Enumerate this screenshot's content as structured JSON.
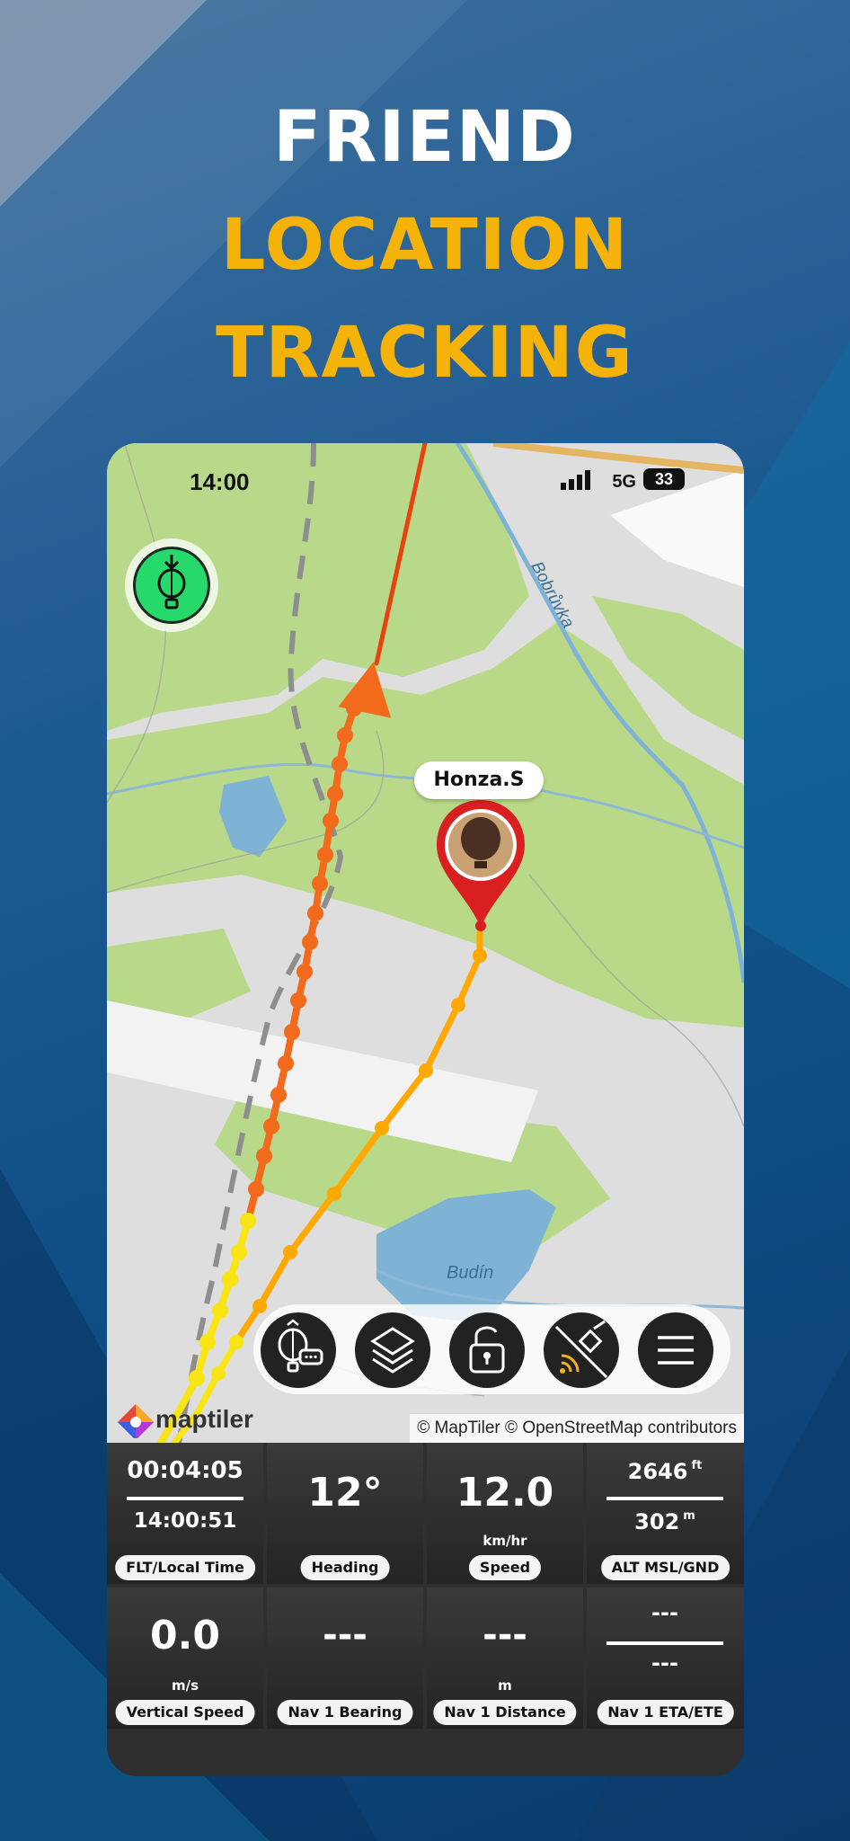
{
  "headline": {
    "line1": "FRIEND",
    "line2": "LOCATION",
    "line3": "TRACKING",
    "line1_color": "#ffffff",
    "accent_color": "#f5b30a"
  },
  "status_bar": {
    "time": "14:00",
    "network": "5G",
    "battery": "33"
  },
  "map": {
    "river_label": "Bobrůvka",
    "lake_label": "Budín",
    "friend_name": "Honza.S",
    "logo_text": "maptiler",
    "attribution": "© MapTiler © OpenStreetMap contributors",
    "track_color_own": "#f26a1b",
    "track_color_friend": "#ffa800",
    "track_color_tail": "#f8e513"
  },
  "toolbar": {
    "icons": [
      "balloon-chat-icon",
      "layers-icon",
      "unlock-icon",
      "satellite-icon",
      "menu-icon"
    ]
  },
  "instruments": {
    "flt_time": "00:04:05",
    "local_time": "14:00:51",
    "flt_label": "FLT/Local Time",
    "heading": "12°",
    "heading_label": "Heading",
    "speed": "12.0",
    "speed_unit": "km/hr",
    "speed_label": "Speed",
    "alt_msl": "2646",
    "alt_msl_unit": "ft",
    "alt_gnd": "302",
    "alt_gnd_unit": "m",
    "alt_label": "ALT MSL/GND",
    "vs": "0.0",
    "vs_unit": "m/s",
    "vs_label": "Vertical Speed",
    "nav_bearing": "---",
    "nav_bearing_label": "Nav 1 Bearing",
    "nav_distance": "---",
    "nav_distance_unit": "m",
    "nav_distance_label": "Nav 1 Distance",
    "nav_eta": "---",
    "nav_ete": "---",
    "nav_eta_label": "Nav 1 ETA/ETE"
  }
}
